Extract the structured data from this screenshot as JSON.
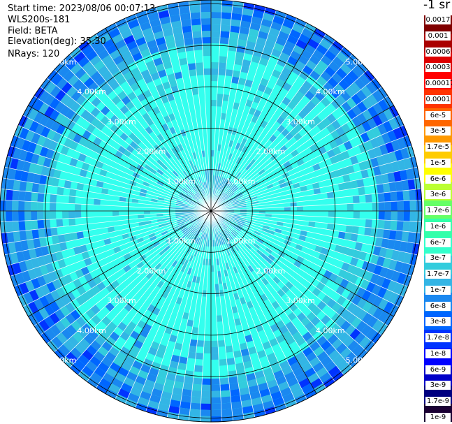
{
  "header": {
    "start_time": "Start time: 2023/08/06 00:07:13",
    "device": "WLS200s-181",
    "field": "Field: BETA",
    "elevation": "Elevation(deg): 35.30",
    "nrays": "NRays: 120"
  },
  "colorbar": {
    "unit": "-1 sr",
    "colors": [
      "#1a0033",
      "#000080",
      "#0000c8",
      "#0000ff",
      "#0033ff",
      "#0066ff",
      "#1a88f0",
      "#33b5e5",
      "#33ccdd",
      "#33ffcc",
      "#33ffaa",
      "#66ff66",
      "#bbff33",
      "#ffff00",
      "#ffcc00",
      "#ff9900",
      "#ff6600",
      "#ff3300",
      "#ff0000",
      "#dd0000",
      "#aa0000",
      "#800000"
    ],
    "labels": [
      "0.0017",
      "0.001",
      "0.0006",
      "0.0003",
      "0.00017",
      "0.0001",
      "6e-5",
      "3e-5",
      "1.7e-5",
      "1e-5",
      "6e-6",
      "3e-6",
      "1.7e-6",
      "1e-6",
      "6e-7",
      "3e-7",
      "1.7e-7",
      "1e-7",
      "6e-8",
      "3e-8",
      "1.7e-8",
      "1e-8",
      "6e-9",
      "3e-9",
      "1.7e-9",
      "1e-9"
    ]
  },
  "polar_plot": {
    "n_rays": 120,
    "range_labels": [
      "1.00km",
      "2.00km",
      "3.00km",
      "4.00km",
      "5.00km"
    ],
    "field_colors": [
      "#33ffee",
      "#33ccdd",
      "#33b5e5",
      "#1a88f0",
      "#0066ff",
      "#0033ff"
    ],
    "grid_color": "#000000",
    "ray_gap_color": "#ffffff"
  }
}
